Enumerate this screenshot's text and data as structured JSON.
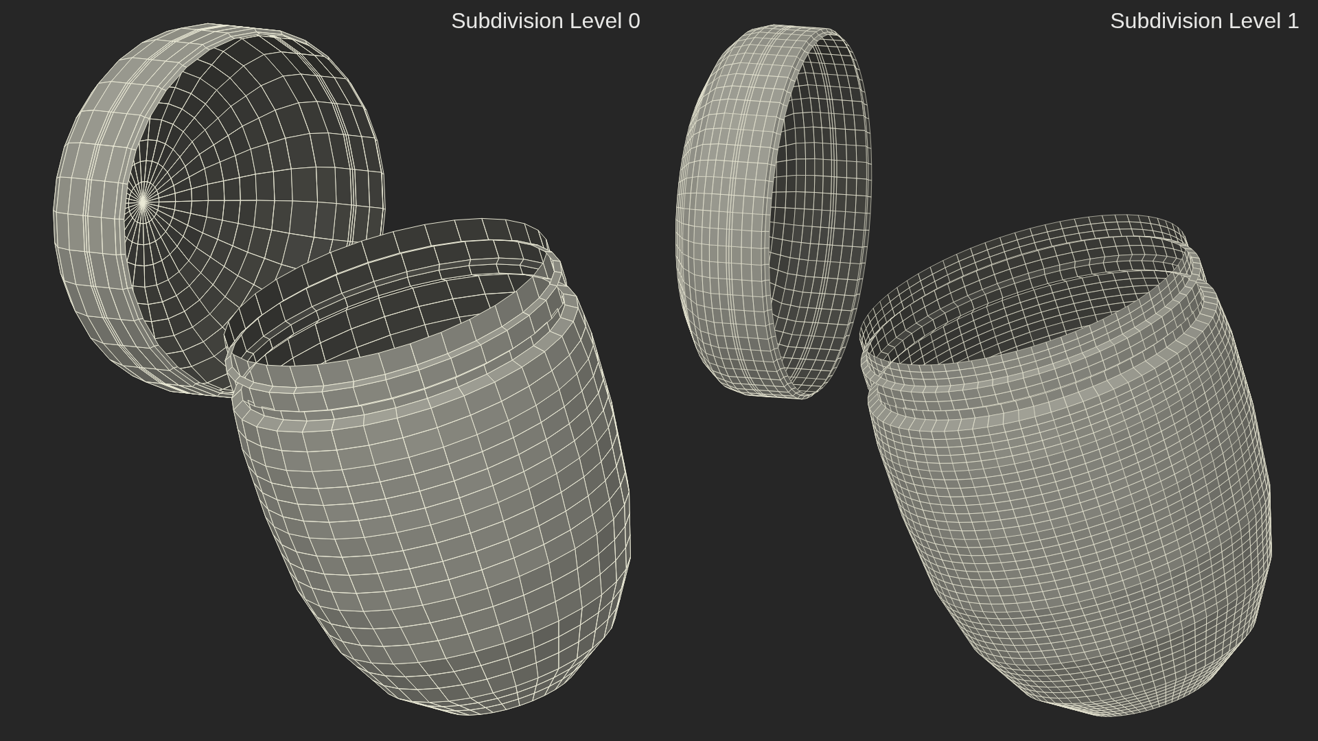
{
  "panels": [
    {
      "label": "Subdivision Level 0",
      "kind": "coarse"
    },
    {
      "label": "Subdivision Level 1",
      "kind": "fine"
    }
  ]
}
